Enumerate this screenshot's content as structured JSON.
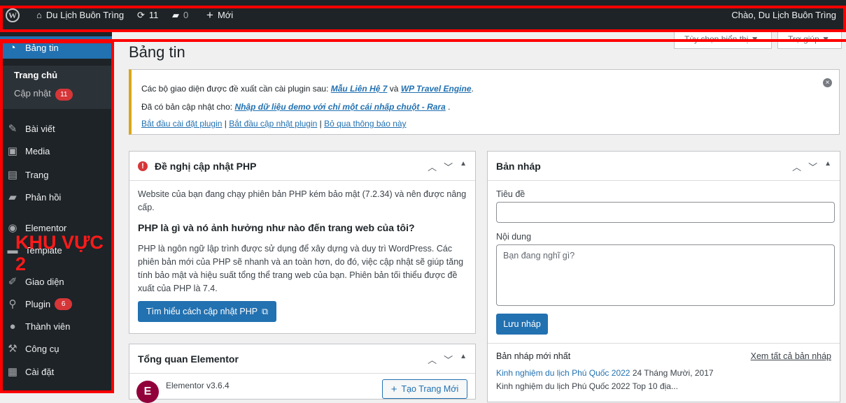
{
  "adminbar": {
    "site_name": "Du Lịch Buôn Trìng",
    "updates_count": "11",
    "comments_count": "0",
    "new_label": "Mới",
    "greeting": "Chào, Du Lịch Buôn Trìng"
  },
  "screen_options": {
    "display_label": "Tùy chọn hiển thị ▼",
    "help_label": "Trợ giúp ▼"
  },
  "sidebar": {
    "current": "Bảng tin",
    "submenu": {
      "home": "Trang chủ",
      "updates": "Cập nhật",
      "updates_badge": "11"
    },
    "items": [
      {
        "label": "Bài viết",
        "icon": "pin-icon"
      },
      {
        "label": "Media",
        "icon": "media-icon"
      },
      {
        "label": "Trang",
        "icon": "page-icon"
      },
      {
        "label": "Phản hồi",
        "icon": "comment-icon"
      },
      {
        "label": "Elementor",
        "icon": "elementor-icon"
      },
      {
        "label": "Template",
        "icon": "folder-icon"
      },
      {
        "label": "Giao diện",
        "icon": "brush-icon"
      },
      {
        "label": "Plugin",
        "icon": "plugin-icon",
        "badge": "6"
      },
      {
        "label": "Thành viên",
        "icon": "user-icon"
      },
      {
        "label": "Công cụ",
        "icon": "wrench-icon"
      },
      {
        "label": "Cài đặt",
        "icon": "settings-icon"
      }
    ],
    "annotation": "KHU VỰC 2"
  },
  "page_title": "Bảng tin",
  "notice": {
    "line1_prefix": "Các bộ giao diện được đề xuất cần cài plugin sau:",
    "line1_link1": "Mẫu Liên Hệ 7",
    "line1_and": "và",
    "line1_link2": "WP Travel Engine",
    "line2_prefix": "Đã có bản cập nhật cho:",
    "line2_link": "Nhập dữ liệu demo với chỉ một cái nhấp chuột - Rara",
    "action_install": "Bắt đầu cài đặt plugin",
    "action_update": "Bắt đầu cập nhật plugin",
    "action_dismiss": "Bỏ qua thông báo này"
  },
  "php_box": {
    "title": "Đề nghị cập nhật PHP",
    "intro": "Website của bạn đang chạy phiên bản PHP kém bảo mật (7.2.34) và nên được nâng cấp.",
    "heading": "PHP là gì và nó ảnh hưởng như nào đến trang web của tôi?",
    "body": "PHP là ngôn ngữ lập trình được sử dụng để xây dựng và duy trì WordPress. Các phiên bản mới của PHP sẽ nhanh và an toàn hơn, do đó, việc cập nhật sẽ giúp tăng tính bảo mật và hiệu suất tổng thể trang web của bạn. Phiên bản tối thiểu được đề xuất của PHP là 7.4.",
    "button": "Tìm hiểu cách cập nhật PHP"
  },
  "elementor_box": {
    "title": "Tổng quan Elementor",
    "version": "Elementor v3.6.4",
    "button": "Tạo Trang Mới"
  },
  "draft_box": {
    "title": "Bản nháp",
    "title_label": "Tiêu đề",
    "content_label": "Nội dung",
    "content_placeholder": "Bạn đang nghĩ gì?",
    "save_button": "Lưu nháp",
    "recent_heading": "Bản nháp mới nhất",
    "view_all": "Xem tất cả bản nháp",
    "recent": [
      {
        "title": "Kinh nghiệm du lịch Phú Quốc 2022",
        "date": "24 Tháng Mười, 2017"
      },
      {
        "title": "Kinh nghiệm du lịch Phú Quốc 2022 Top 10 địa..."
      }
    ]
  },
  "colors": {
    "annotation_red": "#ff0000",
    "wp_blue": "#2271b1",
    "adminbar": "#1d2327"
  }
}
